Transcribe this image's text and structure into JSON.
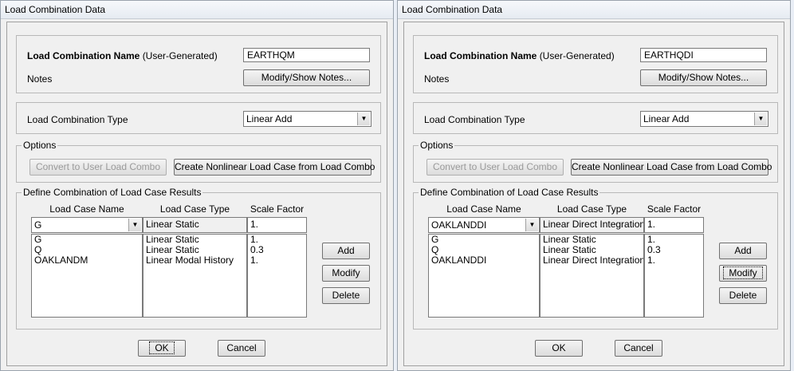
{
  "windows": [
    {
      "title": "Load Combination Data",
      "name_label": "Load Combination Name",
      "name_suffix": "(User-Generated)",
      "name_value": "EARTHQM",
      "notes_label": "Notes",
      "notes_button": "Modify/Show Notes...",
      "type_label": "Load Combination Type",
      "type_value": "Linear Add",
      "options_legend": "Options",
      "convert_button": "Convert to User Load Combo",
      "create_button": "Create Nonlinear Load Case from Load Combo",
      "define_legend": "Define Combination of Load Case Results",
      "col_case_name": "Load Case Name",
      "col_case_type": "Load Case Type",
      "col_scale": "Scale Factor",
      "edit_case_name": "G",
      "edit_case_type": "Linear Static",
      "edit_scale": "1.",
      "rows": [
        {
          "name": "G",
          "type": "Linear Static",
          "scale": "1."
        },
        {
          "name": "Q",
          "type": "Linear Static",
          "scale": "0.3"
        },
        {
          "name": "OAKLANDM",
          "type": "Linear Modal History",
          "scale": "1."
        }
      ],
      "add_button": "Add",
      "modify_button": "Modify",
      "delete_button": "Delete",
      "ok_button": "OK",
      "cancel_button": "Cancel"
    },
    {
      "title": "Load Combination Data",
      "name_label": "Load Combination Name",
      "name_suffix": "(User-Generated)",
      "name_value": "EARTHQDI",
      "notes_label": "Notes",
      "notes_button": "Modify/Show Notes...",
      "type_label": "Load Combination Type",
      "type_value": "Linear Add",
      "options_legend": "Options",
      "convert_button": "Convert to User Load Combo",
      "create_button": "Create Nonlinear Load Case from Load Combo",
      "define_legend": "Define Combination of Load Case Results",
      "col_case_name": "Load Case Name",
      "col_case_type": "Load Case Type",
      "col_scale": "Scale Factor",
      "edit_case_name": "OAKLANDDI",
      "edit_case_type": "Linear Direct Integration",
      "edit_scale": "1.",
      "rows": [
        {
          "name": "G",
          "type": "Linear Static",
          "scale": "1."
        },
        {
          "name": "Q",
          "type": "Linear Static",
          "scale": "0.3"
        },
        {
          "name": "OAKLANDDI",
          "type": "Linear Direct Integration Hi",
          "scale": "1."
        }
      ],
      "add_button": "Add",
      "modify_button": "Modify",
      "delete_button": "Delete",
      "ok_button": "OK",
      "cancel_button": "Cancel"
    }
  ]
}
